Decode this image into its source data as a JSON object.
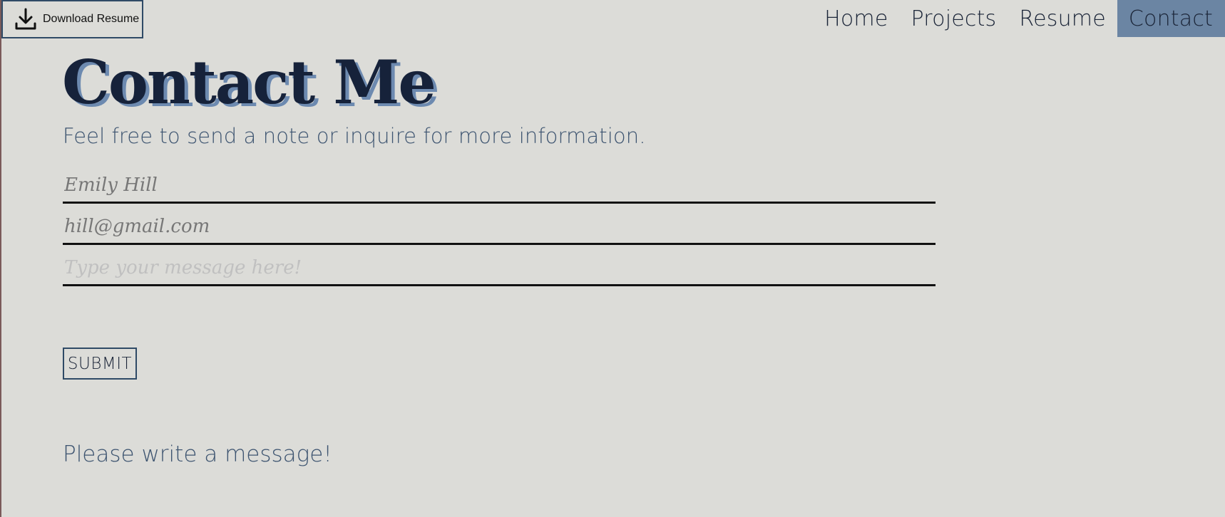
{
  "download": {
    "label": "Download Resume",
    "icon": "download-icon"
  },
  "nav": {
    "items": [
      {
        "label": "Home"
      },
      {
        "label": "Projects"
      },
      {
        "label": "Resume"
      },
      {
        "label": "Contact",
        "active": true
      }
    ]
  },
  "colors": {
    "background": "#dcdcd8",
    "accent": "#6b85a3",
    "title": "#16223a",
    "title_shadow": "#6d8ab0",
    "subtext": "#3d5470"
  },
  "page": {
    "title": "Contact Me",
    "subtitle": "Feel free to send a note or inquire for more information."
  },
  "form": {
    "name_value": "Emily Hill",
    "email_value": "hill@gmail.com",
    "message_placeholder": "Type your message here!",
    "submit_label": "SUBMIT"
  },
  "status": {
    "message": "Please write a message!"
  }
}
